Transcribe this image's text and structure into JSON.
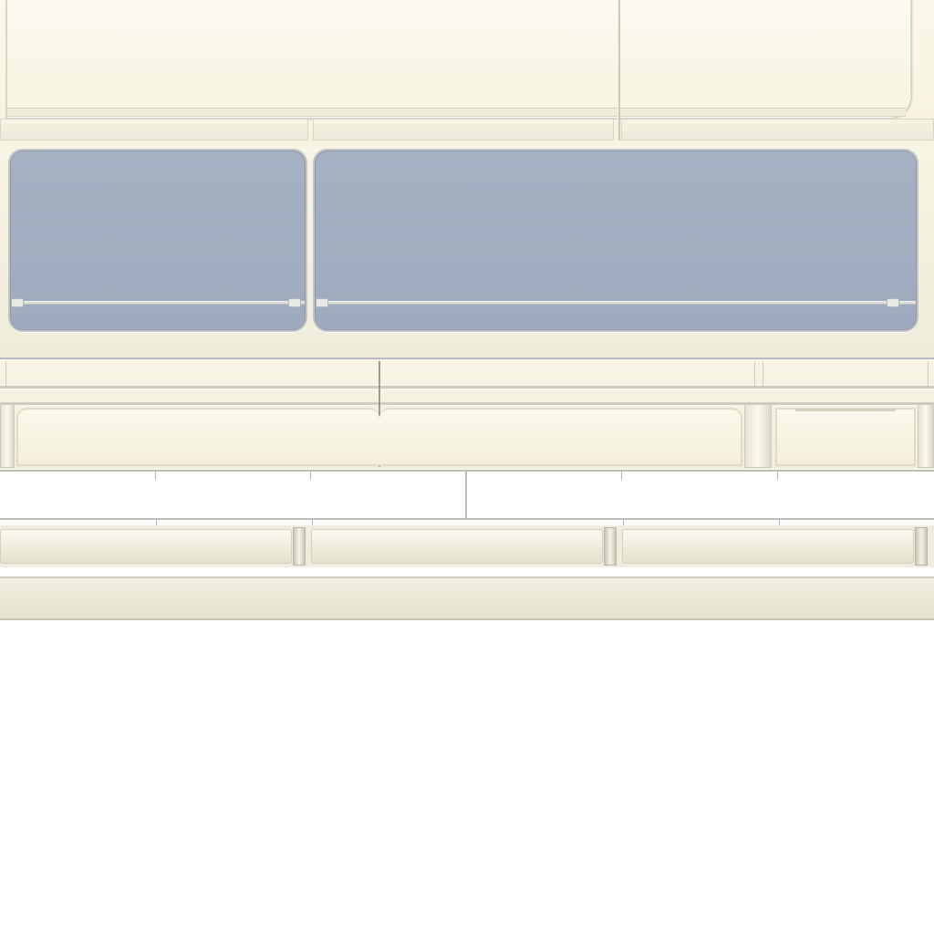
{
  "panel": {
    "colors": {
      "cream": "#f6f2dd",
      "window_blue": "#a2adc0",
      "frame_gray": "#c5c6c4",
      "slot_white": "#ffffff"
    },
    "window_count": 2,
    "slot_count": 2,
    "pipe_count": 3
  }
}
